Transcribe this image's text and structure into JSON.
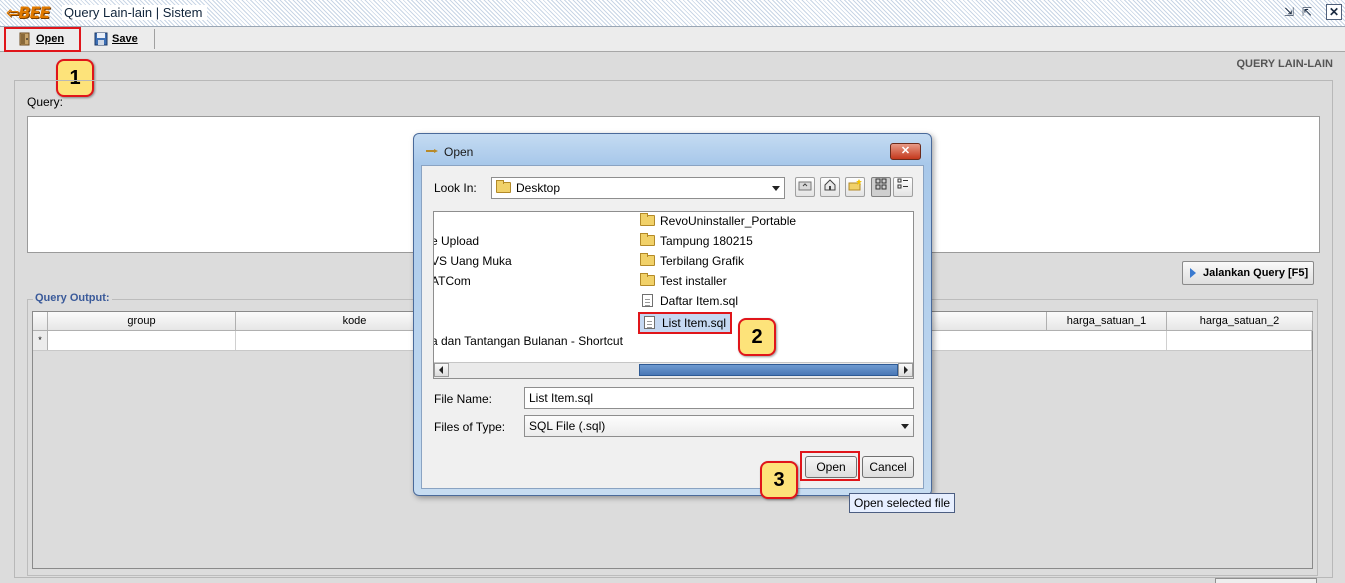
{
  "window": {
    "logo_text": "BEE",
    "title": "Query Lain-lain | Sistem",
    "controls": {
      "restore": "⇲",
      "minimize": "⇱",
      "close": "✕"
    }
  },
  "toolbar": {
    "open_label": "Open",
    "save_label": "Save"
  },
  "page": {
    "heading": "QUERY LAIN-LAIN",
    "query_label": "Query:",
    "run_button": "Jalankan Query [F5]",
    "output_label": "Query Output:"
  },
  "grid": {
    "columns": [
      "group",
      "kode",
      "harga_satuan_1",
      "harga_satuan_2"
    ],
    "new_row_marker": "*"
  },
  "dialog": {
    "title": "Open",
    "close_label": "✕",
    "look_in_label": "Look In:",
    "look_in_value": "Desktop",
    "files_left": [
      "e Upload",
      "VS Uang Muka",
      "ATCom",
      "a dan Tantangan Bulanan - Shortcut"
    ],
    "files_right": [
      {
        "name": "RevoUninstaller_Portable",
        "type": "folder"
      },
      {
        "name": "Tampung 180215",
        "type": "folder"
      },
      {
        "name": "Terbilang Grafik",
        "type": "folder"
      },
      {
        "name": "Test installer",
        "type": "folder"
      },
      {
        "name": "Daftar Item.sql",
        "type": "file"
      },
      {
        "name": "List Item.sql",
        "type": "file"
      }
    ],
    "file_name_label": "File Name:",
    "file_name_value": "List Item.sql",
    "file_type_label": "Files of Type:",
    "file_type_value": "SQL File (.sql)",
    "open_button": "Open",
    "cancel_button": "Cancel",
    "tooltip": "Open selected file"
  },
  "annotations": {
    "step1": "1",
    "step2": "2",
    "step3": "3"
  },
  "colors": {
    "highlight": "#e0151a",
    "badge": "#fde37a",
    "selection": "#c5d8f2"
  }
}
